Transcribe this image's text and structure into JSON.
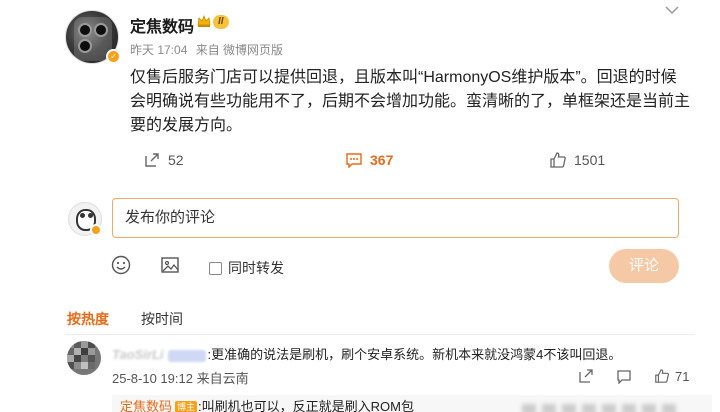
{
  "post": {
    "author": "定焦数码",
    "level_badge": "II",
    "time": "昨天 17:04",
    "source": "来自 微博网页版",
    "content": "仅售后服务门店可以提供回退，且版本叫“HarmonyOS维护版本”。回退的时候会明确说有些功能用不了，后期不会增加功能。蛮清晰的了，单框架还是当前主要的发展方向。",
    "reposts": "52",
    "comments": "367",
    "likes": "1501"
  },
  "comment_box": {
    "placeholder": "发布你的评论",
    "repost_option": "同时转发",
    "submit_label": "评论"
  },
  "sort_tabs": {
    "hot": "按热度",
    "time": "按时间"
  },
  "comments": [
    {
      "user": "TaoSirLi",
      "text": ":更准确的说法是刷机，刷个安卓系统。新机本来就没鸿蒙4不该叫回退。",
      "meta": "25-8-10 19:12 来自云南",
      "likes": "71",
      "reply": {
        "user": "定焦数码",
        "badge": "博主",
        "text": ":叫刷机也可以，反正就是刷入ROM包"
      }
    }
  ],
  "colors": {
    "accent": "#e86b1a",
    "input_border": "#f0a86b",
    "submit_bg": "#f6c9a6",
    "badge_gold": "#f7a11a"
  },
  "icons": {
    "more": "chevron-down-icon",
    "repost": "repost-icon",
    "comment": "comment-icon",
    "like": "thumbs-up-icon",
    "emoji": "smiley-icon",
    "image": "image-icon"
  }
}
